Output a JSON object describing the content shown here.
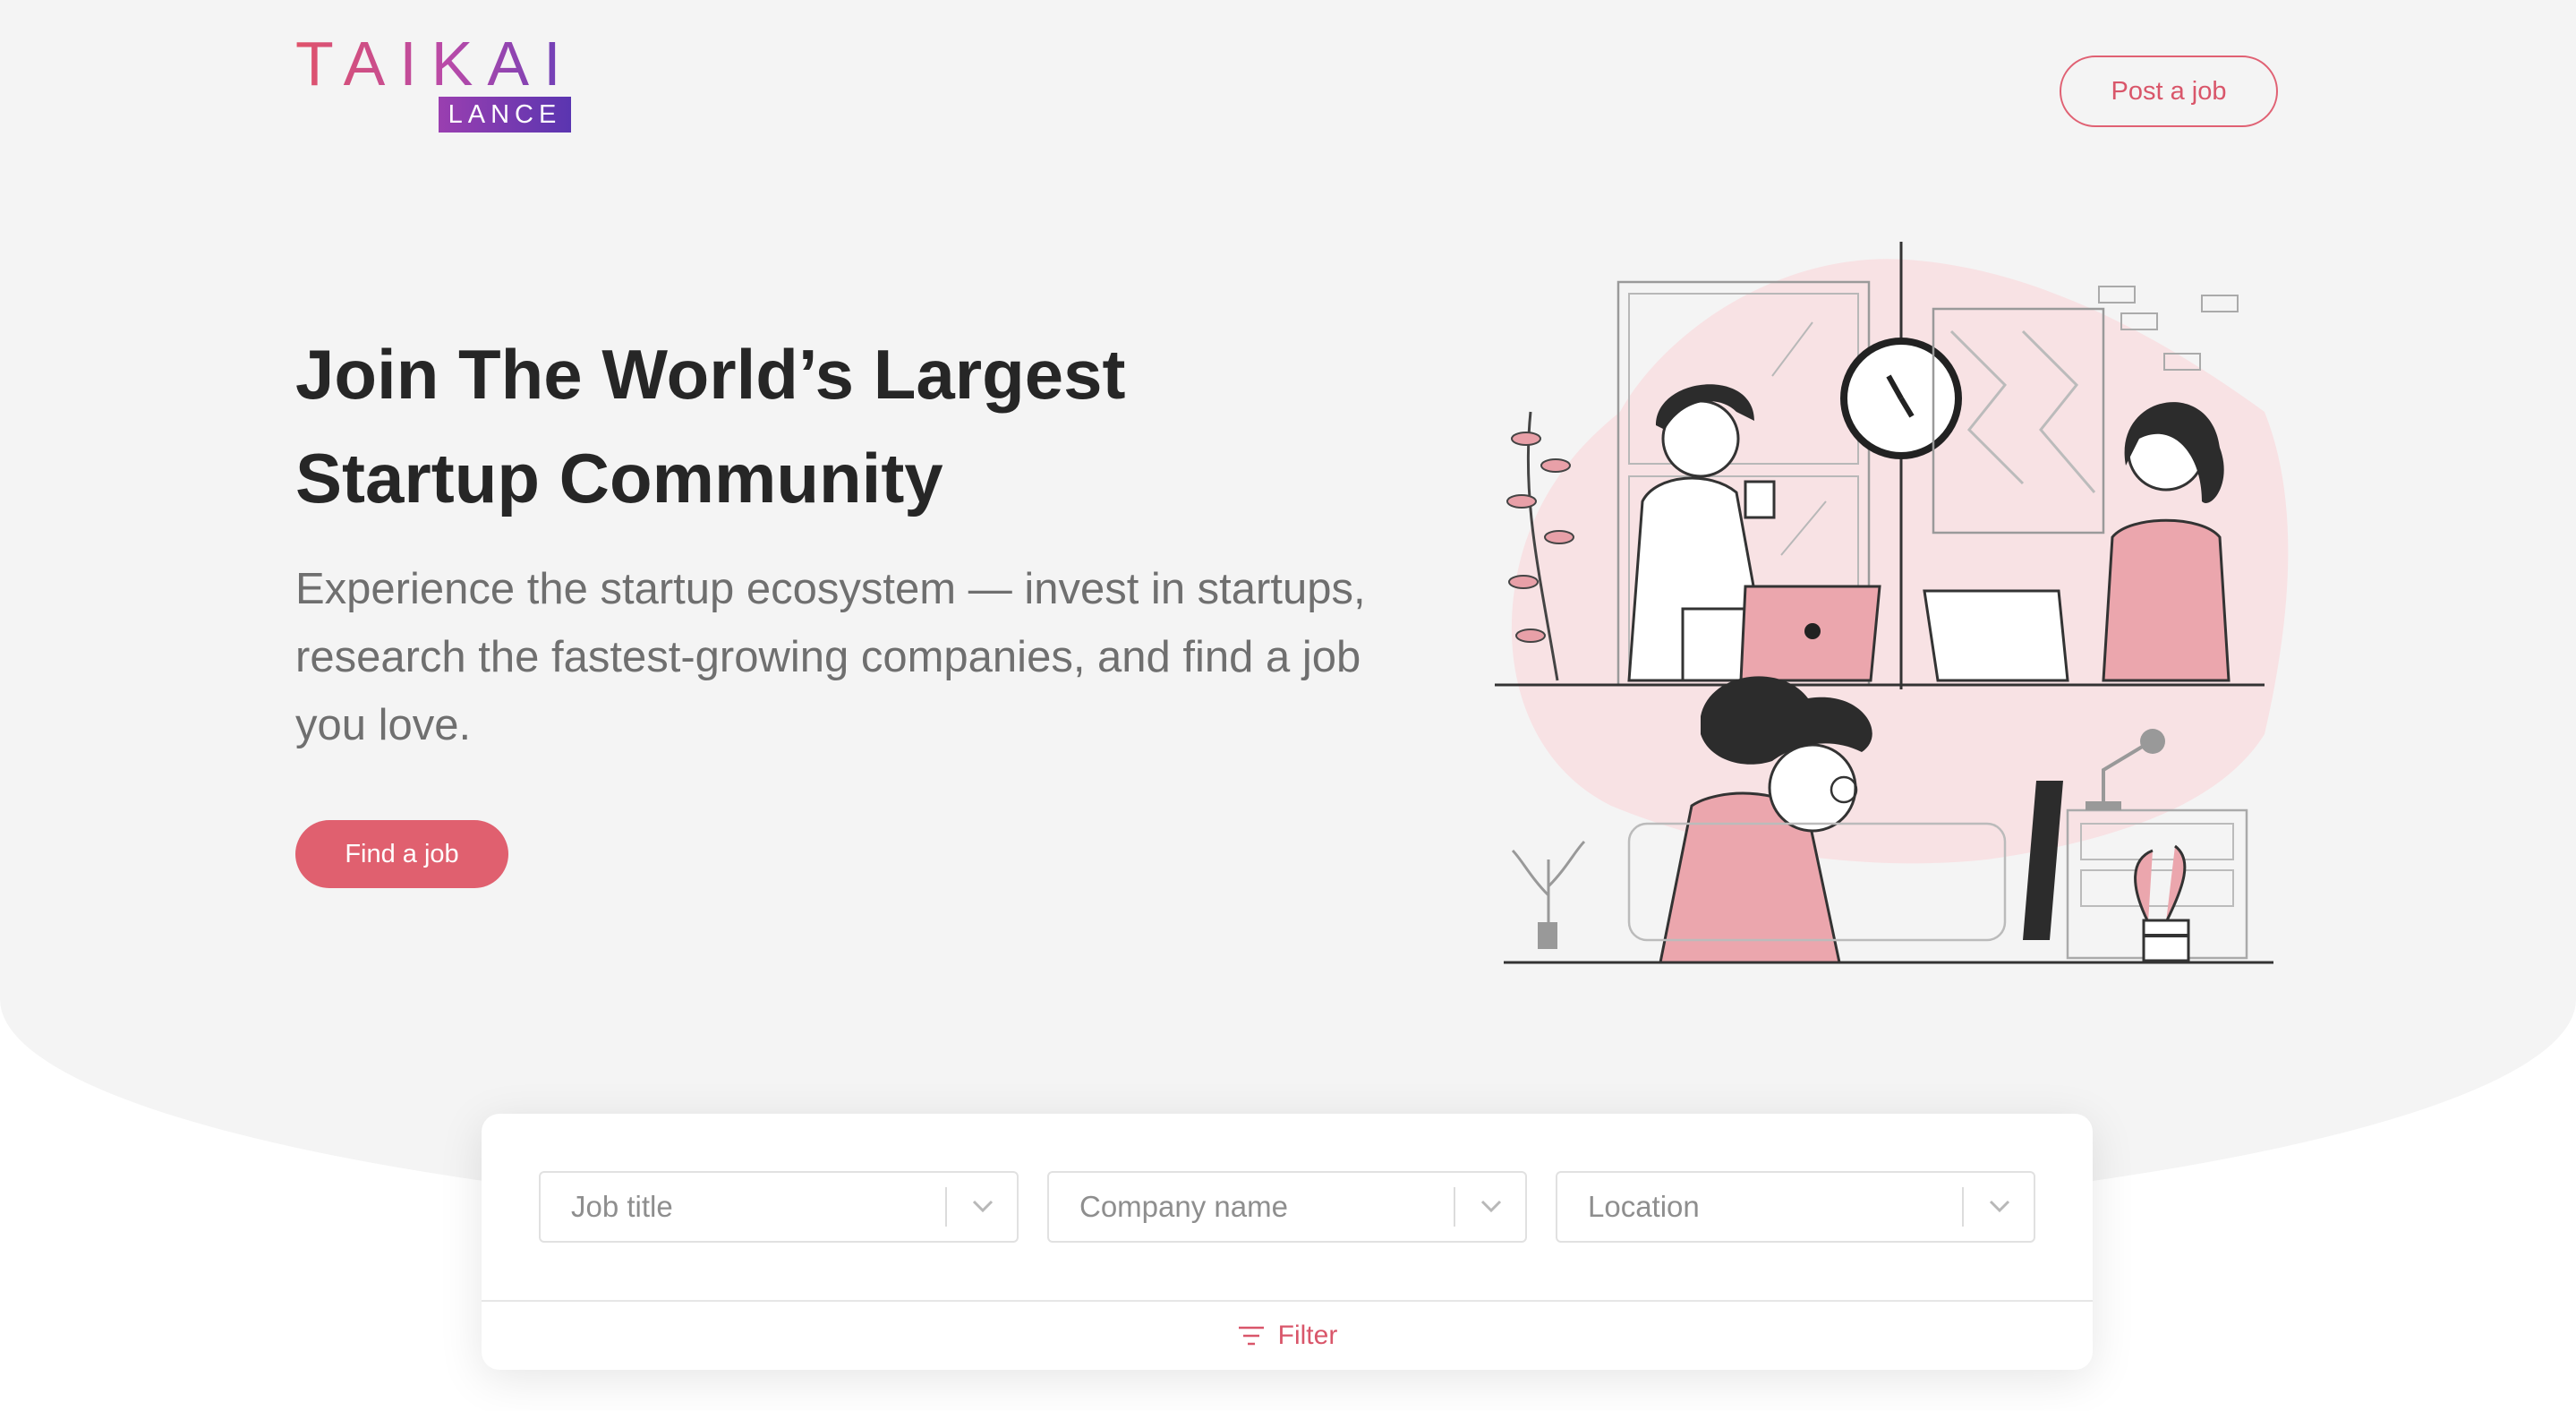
{
  "brand": {
    "name": "TAIKAI",
    "sub": "LANCE"
  },
  "header": {
    "post_job_label": "Post a job"
  },
  "hero": {
    "title_line1": "Join The World’s Largest",
    "title_line2": "Startup Community",
    "subtitle": "Experience the startup ecosystem — invest in startups, research the fastest-growing companies, and find a job you love.",
    "cta_label": "Find a job",
    "illustration_icon": "people-working-illustration"
  },
  "search": {
    "job_title": {
      "placeholder": "Job title",
      "value": ""
    },
    "company": {
      "placeholder": "Company name",
      "value": ""
    },
    "location": {
      "placeholder": "Location",
      "value": ""
    },
    "filter_label": "Filter",
    "filter_icon": "filter-lines-icon"
  },
  "colors": {
    "accent": "#e0606f",
    "brand_gradient": [
      "#e0536a",
      "#6b3fb8"
    ],
    "background": "#f4f4f4"
  }
}
